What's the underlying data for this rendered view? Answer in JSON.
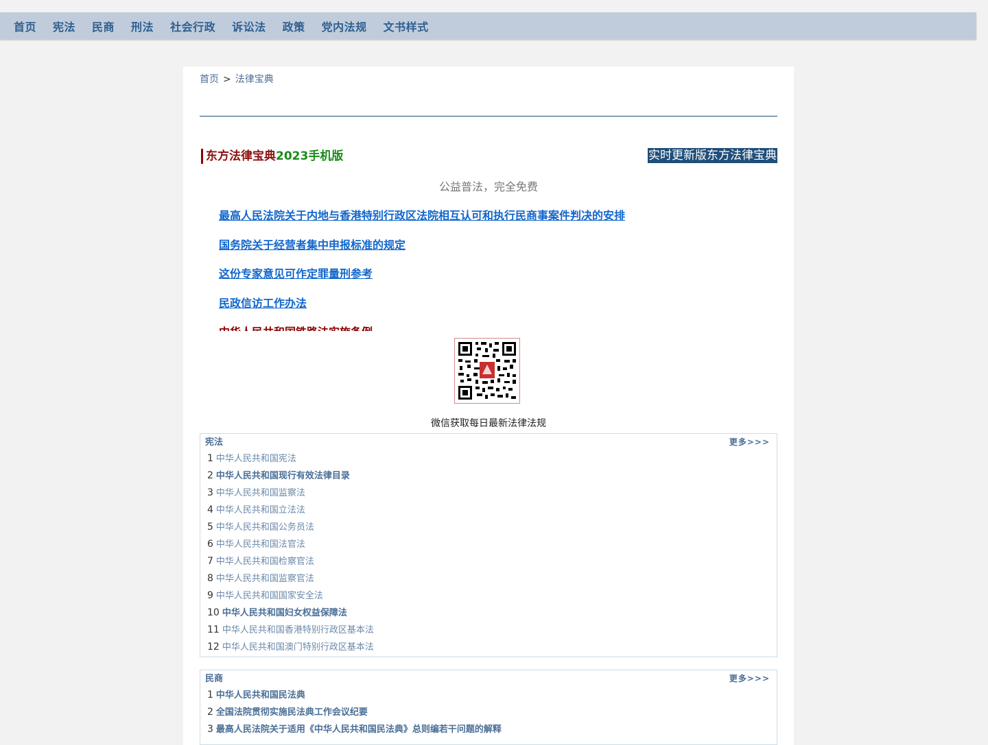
{
  "nav": [
    "首页",
    "宪法",
    "民商",
    "刑法",
    "社会行政",
    "诉讼法",
    "政策",
    "党内法规",
    "文书样式"
  ],
  "breadcrumb": {
    "home": "首页",
    "sep": ">",
    "current": "法律宝典"
  },
  "promo": {
    "title_part1": "东方法律宝典",
    "title_part2": "2023手机版",
    "right_label": "实时更新版东方法律宝典",
    "slogan": "公益普法，完全免费"
  },
  "featured_links": [
    "最高人民法院关于内地与香港特别行政区法院相互认可和执行民商事案件判决的安排",
    "国务院关于经营者集中申报标准的规定",
    "这份专家意见可作定罪量刑参考",
    "民政信访工作办法",
    "中华人民共和国铁路法实施条例"
  ],
  "qr_caption": "微信获取每日最新法律法规",
  "sections": [
    {
      "name": "宪法",
      "more": "更多>>>",
      "items": [
        {
          "n": "1",
          "title": "中华人民共和国宪法",
          "bold": false
        },
        {
          "n": "2",
          "title": "中华人民共和国现行有效法律目录",
          "bold": true
        },
        {
          "n": "3",
          "title": "中华人民共和国监察法",
          "bold": false
        },
        {
          "n": "4",
          "title": "中华人民共和国立法法",
          "bold": false
        },
        {
          "n": "5",
          "title": "中华人民共和国公务员法",
          "bold": false
        },
        {
          "n": "6",
          "title": "中华人民共和国法官法",
          "bold": false
        },
        {
          "n": "7",
          "title": "中华人民共和国检察官法",
          "bold": false
        },
        {
          "n": "8",
          "title": "中华人民共和国监察官法",
          "bold": false
        },
        {
          "n": "9",
          "title": "中华人民共和国国家安全法",
          "bold": false
        },
        {
          "n": "10",
          "title": "中华人民共和国妇女权益保障法",
          "bold": true
        },
        {
          "n": "11",
          "title": "中华人民共和国香港特别行政区基本法",
          "bold": false
        },
        {
          "n": "12",
          "title": "中华人民共和国澳门特别行政区基本法",
          "bold": false
        }
      ]
    },
    {
      "name": "民商",
      "more": "更多>>>",
      "items": [
        {
          "n": "1",
          "title": "中华人民共和国民法典",
          "bold": true
        },
        {
          "n": "2",
          "title": "全国法院贯彻实施民法典工作会议纪要",
          "bold": true
        },
        {
          "n": "3",
          "title": "最高人民法院关于适用《中华人民共和国民法典》总则编若干问题的解释",
          "bold": true
        }
      ]
    }
  ]
}
